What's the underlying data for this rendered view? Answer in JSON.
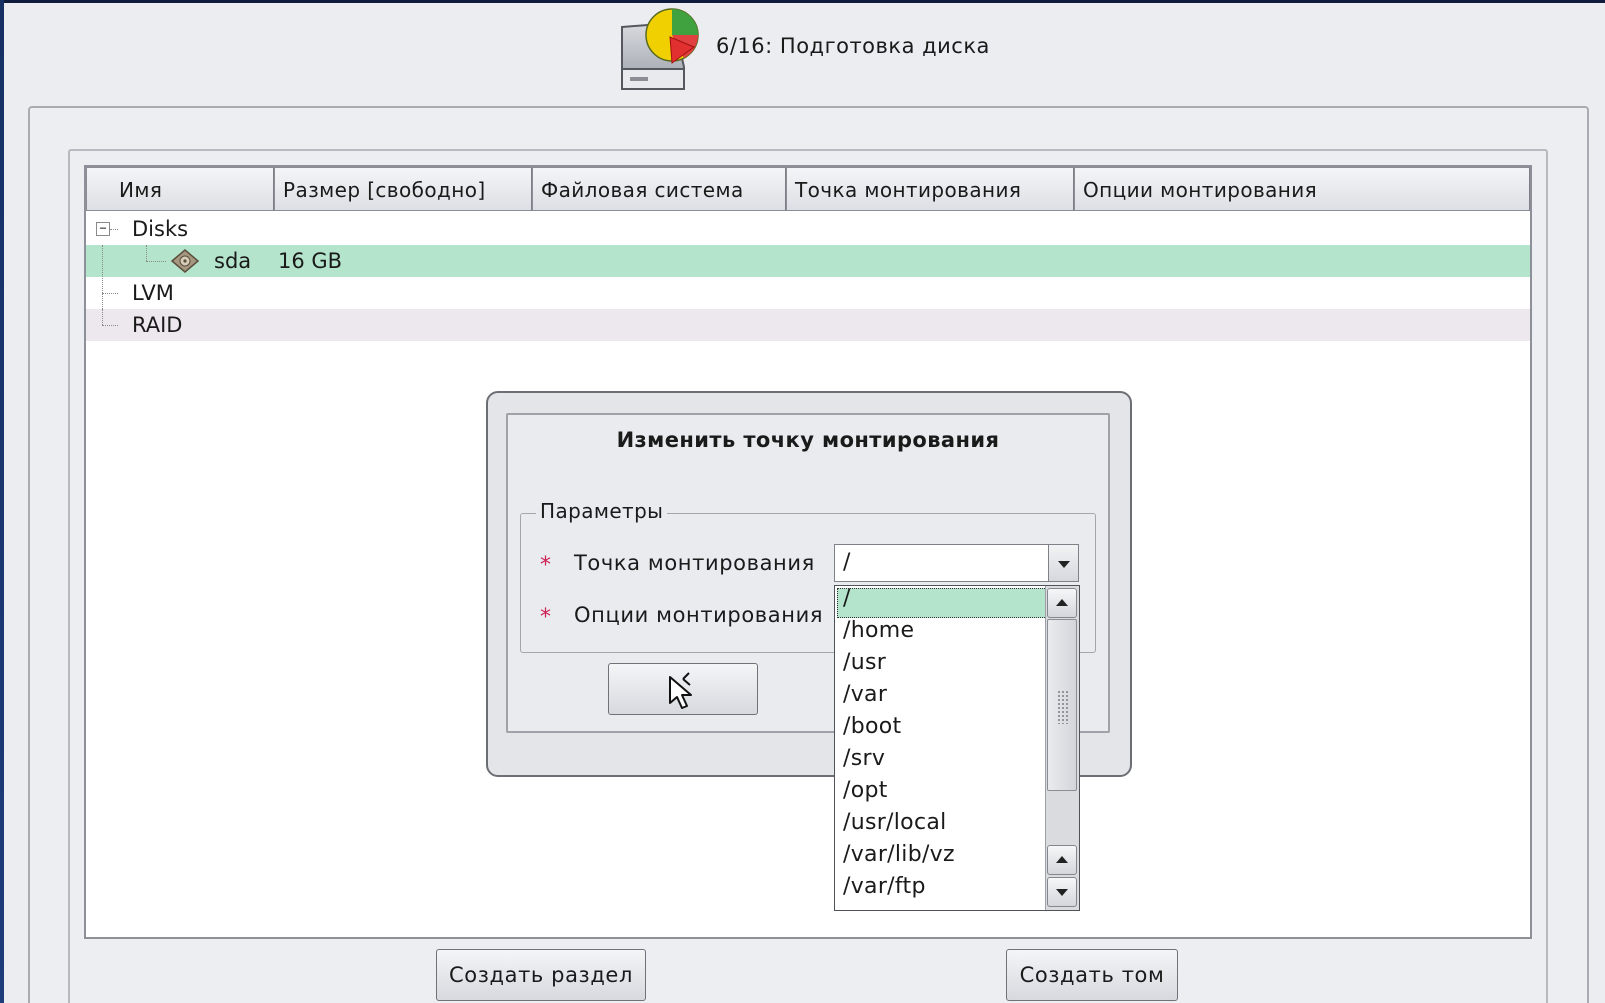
{
  "header": {
    "title": "6/16: Подготовка диска",
    "icon": "disk-partition-icon"
  },
  "table": {
    "columns": [
      "Имя",
      "Размер [свободно]",
      "Файловая система",
      "Точка монтирования",
      "Опции монтирования"
    ],
    "rows": [
      {
        "name": "Disks"
      },
      {
        "name": "sda",
        "size": "16 GB",
        "selected": true
      },
      {
        "name": "LVM"
      },
      {
        "name": "RAID"
      }
    ]
  },
  "dialog": {
    "title": "Изменить точку монтирования",
    "group_label": "Параметры",
    "required_mark": "*",
    "mount_point_label": "Точка монтирования",
    "mount_options_label": "Опции монтирования",
    "mount_point_value": "/"
  },
  "dropdown": {
    "options": [
      "/",
      "/home",
      "/usr",
      "/var",
      "/boot",
      "/srv",
      "/opt",
      "/usr/local",
      "/var/lib/vz",
      "/var/ftp"
    ],
    "selected_index": 0
  },
  "buttons": {
    "create_partition": "Создать раздел",
    "create_volume": "Создать том"
  },
  "colors": {
    "selection": "#b4e4cc",
    "required_mark": "#cc2255",
    "background": "#ecedf0"
  }
}
